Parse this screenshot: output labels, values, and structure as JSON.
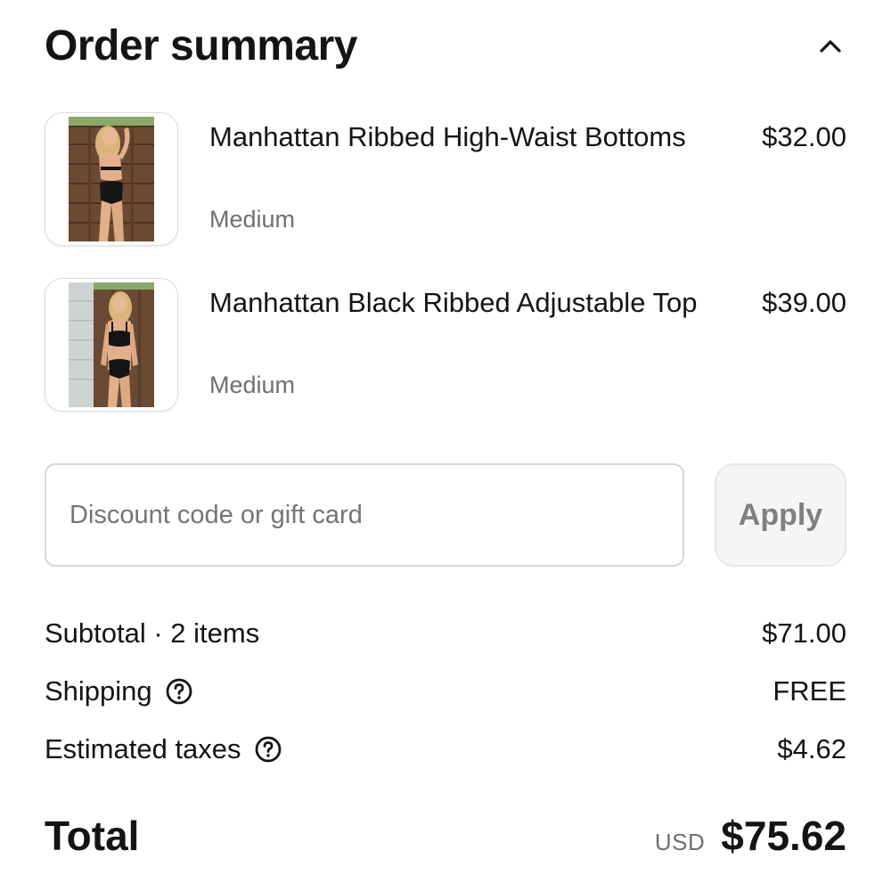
{
  "header": {
    "title": "Order summary",
    "toggle_icon": "chevron-up-icon"
  },
  "items": [
    {
      "name": "Manhattan Ribbed High-Waist Bottoms",
      "variant": "Medium",
      "price": "$32.00",
      "image_icon": "product-photo-bottoms"
    },
    {
      "name": "Manhattan Black Ribbed Adjustable Top",
      "variant": "Medium",
      "price": "$39.00",
      "image_icon": "product-photo-top"
    }
  ],
  "discount": {
    "placeholder": "Discount code or gift card",
    "value": "",
    "apply_label": "Apply"
  },
  "summary": {
    "subtotal_label": "Subtotal · 2 items",
    "subtotal_value": "$71.00",
    "shipping_label": "Shipping",
    "shipping_value": "FREE",
    "taxes_label": "Estimated taxes",
    "taxes_value": "$4.62",
    "help_icon": "question-circle-icon"
  },
  "total": {
    "label": "Total",
    "currency": "USD",
    "amount": "$75.62"
  },
  "colors": {
    "text_primary": "#141414",
    "text_secondary": "#707070",
    "border": "#d6d6d6",
    "button_bg": "#f5f5f5",
    "button_text": "#7f7f7f"
  }
}
